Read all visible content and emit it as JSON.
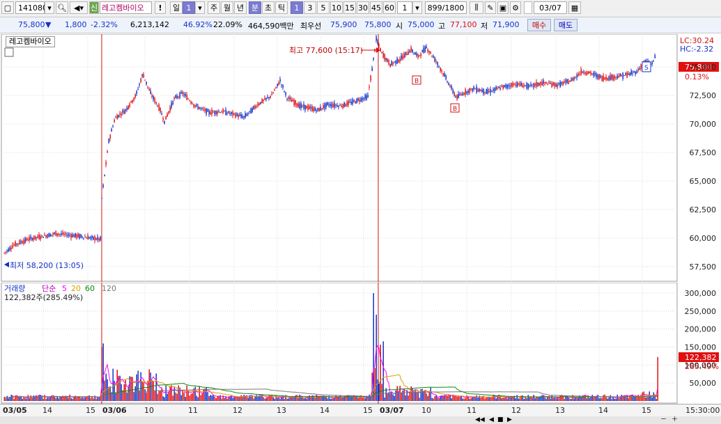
{
  "toolbar": {
    "code": "141080",
    "badge": "신",
    "name": "레고켐바이오",
    "exclaim": "!",
    "period_day": "일",
    "period_num": "1",
    "periods": [
      "주",
      "월",
      "년",
      "분",
      "초",
      "틱"
    ],
    "minutes": [
      "1",
      "3",
      "5",
      "10",
      "15",
      "30",
      "45",
      "60"
    ],
    "unit_value": "1",
    "count": "899/1800",
    "date": "03/07"
  },
  "quote": {
    "price": "75,800",
    "change": "1,800",
    "change_pct": "-2.32%",
    "volume": "6,213,142",
    "pct1": "46.92%",
    "pct2": "22.09%",
    "amount": "464,590백만",
    "best_label": "최우선",
    "best_ask": "75,900",
    "best_bid": "75,800",
    "open_label": "시",
    "open": "75,000",
    "high_label": "고",
    "high": "77,100",
    "low_label": "저",
    "low": "71,900",
    "buy_label": "매수",
    "sell_label": "매도"
  },
  "price_chart": {
    "legend": "레고켐바이오",
    "lc": "LC:30.24",
    "hc": "HC:-2.32",
    "high_annot": "최고 77,600 (15:17)",
    "low_annot": "최저 58,200 (13:05)",
    "last_price": "75,800",
    "last_pct": "0.13%",
    "marker_b": "B",
    "marker_s": "S",
    "y_ticks": [
      "75,000",
      "72,500",
      "70,000",
      "67,500",
      "65,000",
      "62,500",
      "60,000",
      "57,500"
    ]
  },
  "volume_chart": {
    "title": "거래량",
    "ma_label": "단순",
    "ma_values": [
      "5",
      "20",
      "60",
      "120"
    ],
    "info": "122,382주(285.49%)",
    "last_vol": "122,382",
    "last_pct": "285.49%",
    "y_ticks": [
      "300,000",
      "250,000",
      "200,000",
      "150,000",
      "100,000",
      "50,000"
    ]
  },
  "x_axis": {
    "labels": [
      "03/05",
      "14",
      "15",
      "03/06",
      "10",
      "11",
      "12",
      "13",
      "14",
      "15",
      "03/07",
      "10",
      "11",
      "12",
      "13",
      "14",
      "15"
    ],
    "time": "15:30:00"
  },
  "colors": {
    "up": "#e01010",
    "down": "#1432c8",
    "vline": "#d01010",
    "ma5": "#ff00ff",
    "ma20": "#d6a000",
    "ma60": "#0a8a0a",
    "ma120": "#777777"
  }
}
